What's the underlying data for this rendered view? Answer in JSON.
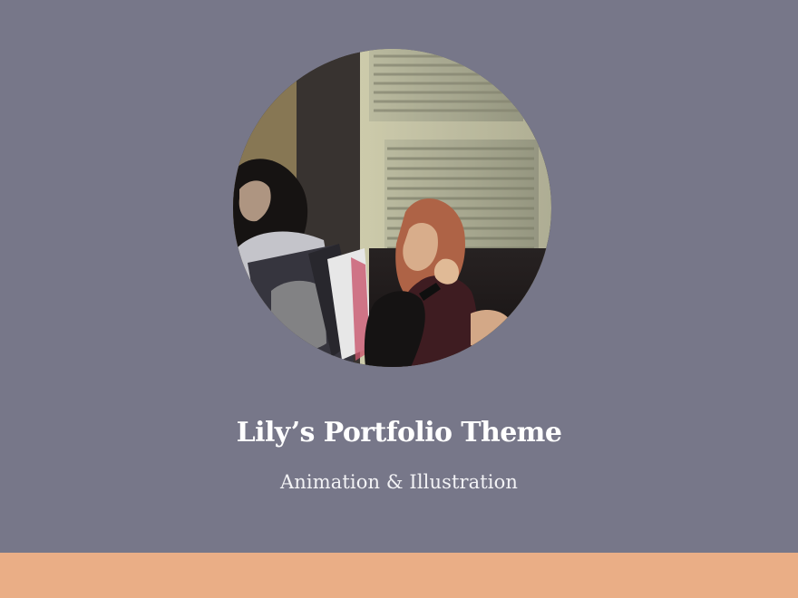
{
  "header": {
    "title": "Lily’s Portfolio Theme",
    "subtitle": "Animation & Illustration"
  },
  "avatar": {
    "icon": "profile-photo"
  },
  "colors": {
    "background": "#777789",
    "accent_bar": "#EAAE86",
    "title_text": "#FFFFFF",
    "subtitle_text": "#F2F2F5"
  }
}
